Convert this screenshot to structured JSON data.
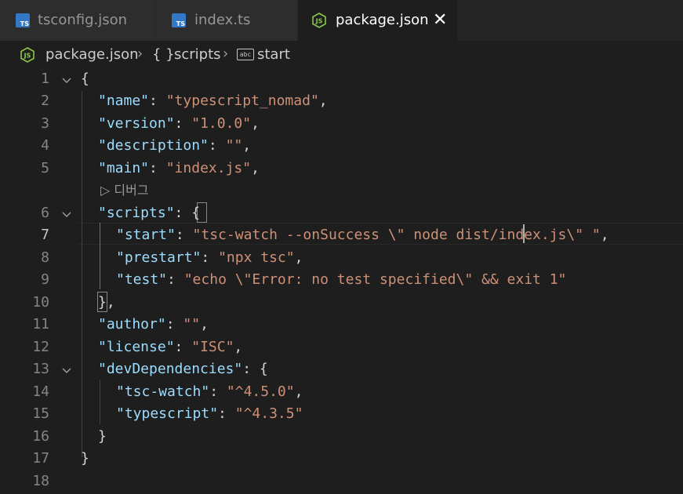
{
  "tabs": [
    {
      "label": "tsconfig.json",
      "icon": "typescript-icon"
    },
    {
      "label": "index.ts",
      "icon": "typescript-icon"
    },
    {
      "label": "package.json",
      "icon": "nodejs-icon",
      "active": true,
      "close": "✕"
    }
  ],
  "breadcrumb": {
    "file": "package.json",
    "sep": "›",
    "scripts_icon": "{ }",
    "scripts": "scripts",
    "start_icon": "abc",
    "start": "start"
  },
  "codelens": "▷ 디버그",
  "line_numbers": [
    "1",
    "2",
    "3",
    "4",
    "5",
    "6",
    "7",
    "8",
    "9",
    "10",
    "11",
    "12",
    "13",
    "14",
    "15",
    "16",
    "17",
    "18"
  ],
  "current_line": "7",
  "code": {
    "l1": {
      "p1": "{"
    },
    "l2": {
      "k": "\"name\"",
      "p1": ": ",
      "s": "\"typescript_nomad\"",
      "p2": ","
    },
    "l3": {
      "k": "\"version\"",
      "p1": ": ",
      "s": "\"1.0.0\"",
      "p2": ","
    },
    "l4": {
      "k": "\"description\"",
      "p1": ": ",
      "s": "\"\"",
      "p2": ","
    },
    "l5": {
      "k": "\"main\"",
      "p1": ": ",
      "s": "\"index.js\"",
      "p2": ","
    },
    "l6": {
      "k": "\"scripts\"",
      "p1": ": ",
      "p2": "{"
    },
    "l7": {
      "k": "\"start\"",
      "p1": ": ",
      "s": "\"tsc-watch --onSuccess \\\" node dist/index.js\\\" \"",
      "p2": ","
    },
    "l8": {
      "k": "\"prestart\"",
      "p1": ": ",
      "s": "\"npx tsc\"",
      "p2": ","
    },
    "l9": {
      "k": "\"test\"",
      "p1": ": ",
      "s": "\"echo \\\"Error: no test specified\\\" && exit 1\""
    },
    "l10": {
      "p1": "}",
      "p2": ","
    },
    "l11": {
      "k": "\"author\"",
      "p1": ": ",
      "s": "\"\"",
      "p2": ","
    },
    "l12": {
      "k": "\"license\"",
      "p1": ": ",
      "s": "\"ISC\"",
      "p2": ","
    },
    "l13": {
      "k": "\"devDependencies\"",
      "p1": ": ",
      "p2": "{"
    },
    "l14": {
      "k": "\"tsc-watch\"",
      "p1": ": ",
      "s": "\"^4.5.0\"",
      "p2": ","
    },
    "l15": {
      "k": "\"typescript\"",
      "p1": ": ",
      "s": "\"^4.3.5\""
    },
    "l16": {
      "p1": "}"
    },
    "l17": {
      "p1": "}"
    }
  },
  "colors": {
    "key": "#9cdcfe",
    "string": "#ce9178",
    "punct": "#d4d4d4",
    "ts_blue": "#3178c6",
    "node_green": "#8cc84b"
  }
}
